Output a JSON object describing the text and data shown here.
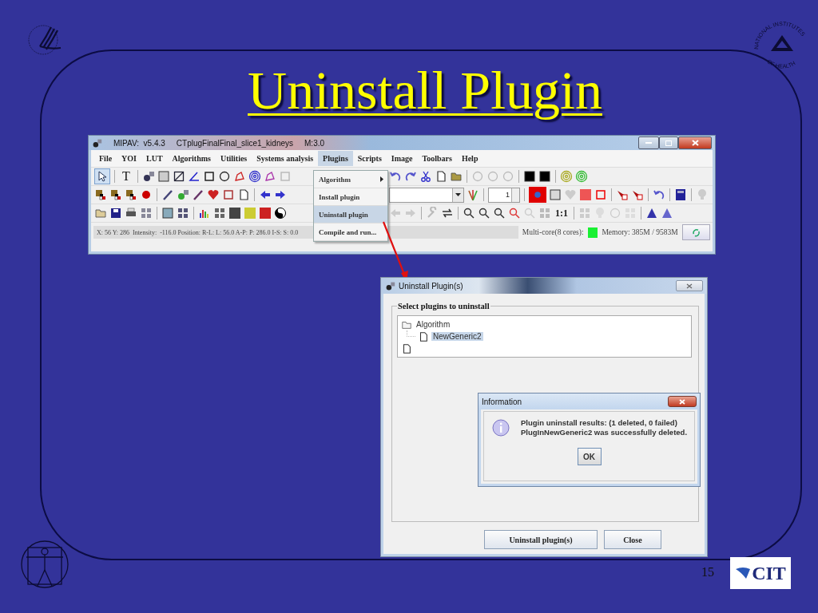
{
  "slide": {
    "title": "Uninstall Plugin",
    "page_number": "15",
    "nih_logo_text": [
      "NATIONAL INSTITUTES",
      "OF HEALTH"
    ],
    "cit_logo_text": "CIT"
  },
  "main_window": {
    "title_parts": [
      "MIPAV:  v5.4.3",
      "CTplugFinalFinal_slice1_kidneys",
      "M:3.0"
    ],
    "menu": [
      {
        "label": "File",
        "selected": false
      },
      {
        "label": "YOI",
        "selected": false
      },
      {
        "label": "LUT",
        "selected": false
      },
      {
        "label": "Algorithms",
        "selected": false
      },
      {
        "label": "Utilities",
        "selected": false
      },
      {
        "label": "Systems analysis",
        "selected": false
      },
      {
        "label": "Plugins",
        "selected": true
      },
      {
        "label": "Scripts",
        "selected": false
      },
      {
        "label": "Image",
        "selected": false
      },
      {
        "label": "Toolbars",
        "selected": false
      },
      {
        "label": "Help",
        "selected": false
      }
    ],
    "plugins_menu": [
      {
        "label": "Algorithm",
        "kind": "submenu",
        "selected": false
      },
      {
        "label": "Install plugin",
        "kind": "item",
        "selected": false
      },
      {
        "label": "Uninstall plugin",
        "kind": "item",
        "selected": true
      },
      {
        "label": "Compile and run...",
        "kind": "item",
        "selected": false
      }
    ],
    "toolbar": {
      "select_tool_selected": true,
      "text_tool": "T",
      "spinner_value": "1",
      "zoom_label": "1:1"
    },
    "status_text": "X: 56 Y: 286  Intensity:  -116.0 Position: R-L: L: 56.0 A-P: P: 286.0 I-S: S: 0.0",
    "multicore_label": "Multi-core(8 cores):",
    "multicore_on": true,
    "memory": "Memory: 385M / 9583M"
  },
  "uninstall_dialog": {
    "title": "Uninstall Plugin(s)",
    "group_label": "Select plugins to uninstall",
    "tree": [
      {
        "label": "Algorithm",
        "kind": "folder",
        "children": [
          {
            "label": "NewGeneric2",
            "kind": "file",
            "selected": true
          }
        ]
      },
      {
        "kind": "file"
      }
    ],
    "buttons": [
      "Uninstall plugin(s)",
      "Close"
    ]
  },
  "info_dialog": {
    "title": "Information",
    "lines": [
      "Plugin uninstall results: (1 deleted, 0 failed)",
      "PlugInNewGeneric2 was successfully deleted."
    ],
    "button": "OK"
  }
}
